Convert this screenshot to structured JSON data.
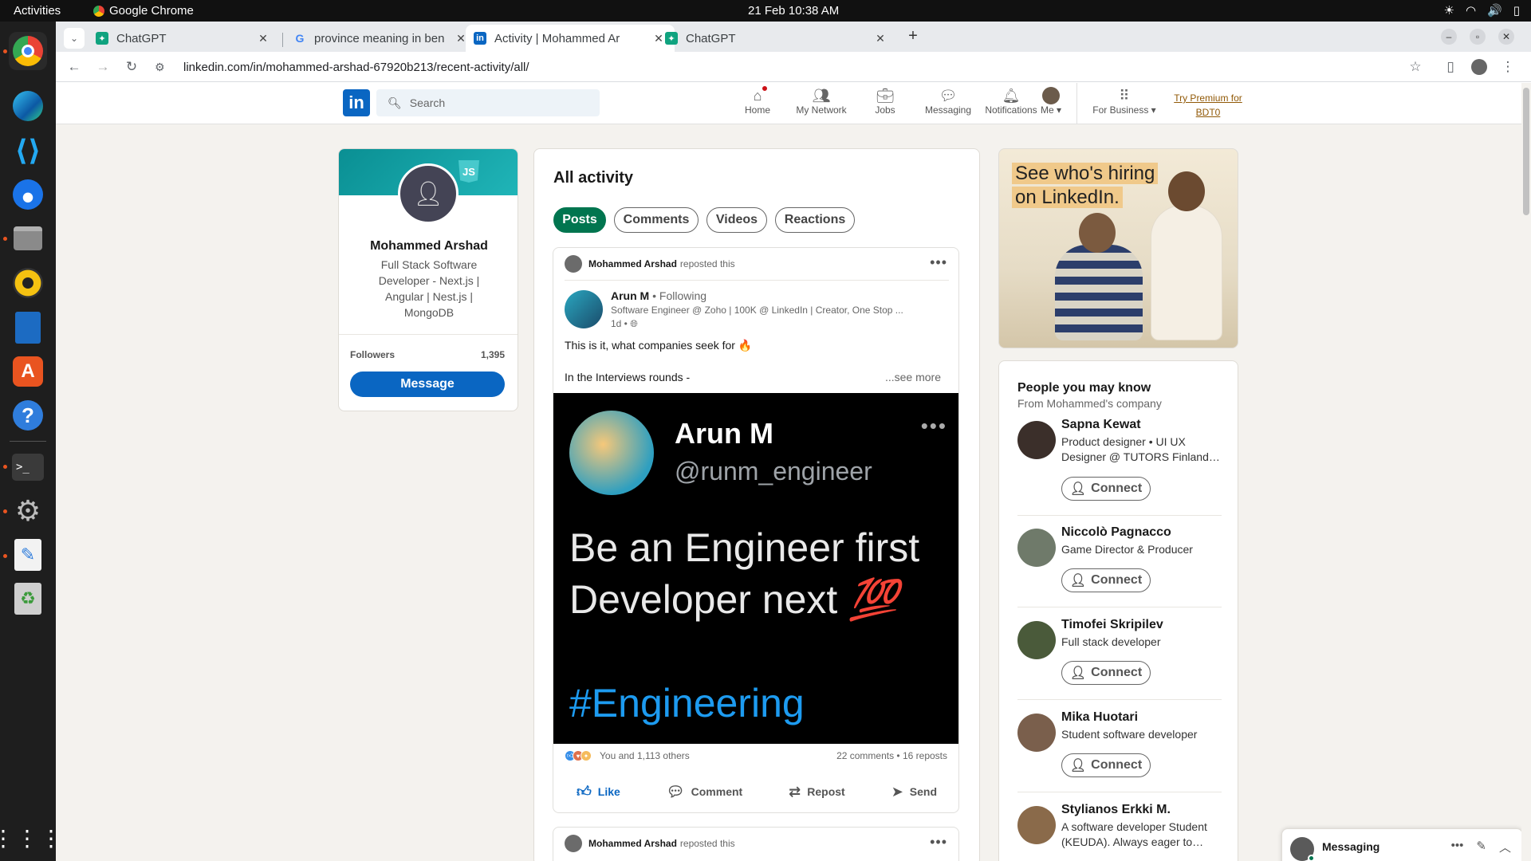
{
  "os": {
    "activities": "Activities",
    "app_name": "Google Chrome",
    "clock": "21 Feb  10:38 AM"
  },
  "browser": {
    "tabs": [
      {
        "title": "ChatGPT",
        "favicon": "chatgpt-icon"
      },
      {
        "title": "province meaning in ben",
        "favicon": "google-icon"
      },
      {
        "title": "Activity | Mohammed Ar",
        "favicon": "linkedin-icon"
      },
      {
        "title": "ChatGPT",
        "favicon": "chatgpt-icon"
      }
    ],
    "url": "linkedin.com/in/mohammed-arshad-67920b213/recent-activity/all/"
  },
  "linkedin": {
    "search_placeholder": "Search",
    "nav": {
      "home": "Home",
      "network": "My Network",
      "jobs": "Jobs",
      "messaging": "Messaging",
      "notifications": "Notifications",
      "me": "Me",
      "business": "For Business",
      "premium_line1": "Try Premium for",
      "premium_line2": "BDT0"
    },
    "profile": {
      "name": "Mohammed Arshad",
      "headline": "Full Stack Software Developer - Next.js | Angular | Nest.js | MongoDB",
      "followers_label": "Followers",
      "followers_count": "1,395",
      "message_button": "Message"
    },
    "feed": {
      "title": "All activity",
      "filters": [
        "Posts",
        "Comments",
        "Videos",
        "Reactions"
      ],
      "post": {
        "reposter": "Mohammed Arshad",
        "repost_text": "reposted this",
        "author": "Arun M",
        "follow_status": "• Following",
        "author_headline": "Software Engineer @ Zoho | 100K @ LinkedIn | Creator, One Stop ...",
        "time": "1d •",
        "text_line1": "This is it, what companies seek for 🔥",
        "text_line2": "In the Interviews rounds -",
        "see_more": "...see more",
        "image": {
          "name": "Arun M",
          "handle": "@runm_engineer",
          "line1": "Be an Engineer first",
          "line2": "Developer next",
          "emoji": "💯",
          "hashtag": "#Engineering"
        },
        "reactions_text": "You and 1,113 others",
        "counts_text": "22 comments • 16 reposts",
        "actions": {
          "like": "Like",
          "comment": "Comment",
          "repost": "Repost",
          "send": "Send"
        }
      },
      "post2": {
        "reposter": "Mohammed Arshad",
        "repost_text": "reposted this"
      }
    },
    "ad": {
      "headline_line1": "See who's hiring",
      "headline_line2": "on LinkedIn."
    },
    "pymk": {
      "title": "People you may know",
      "subtitle": "From Mohammed's company",
      "connect_label": "Connect",
      "people": [
        {
          "name": "Sapna Kewat",
          "headline": "Product designer • UI UX Designer @ TUTORS Finland…"
        },
        {
          "name": "Niccolò Pagnacco",
          "headline": "Game Director & Producer"
        },
        {
          "name": "Timofei Skripilev",
          "headline": "Full stack developer"
        },
        {
          "name": "Mika Huotari",
          "headline": "Student software developer"
        },
        {
          "name": "Stylianos Erkki M.",
          "headline": "A software developer Student (KEUDA). Always eager to…"
        }
      ]
    },
    "messaging": {
      "label": "Messaging"
    }
  },
  "colors": {
    "linkedin_blue": "#0a66c2",
    "posts_green": "#01754f",
    "premium_gold": "#915907"
  }
}
